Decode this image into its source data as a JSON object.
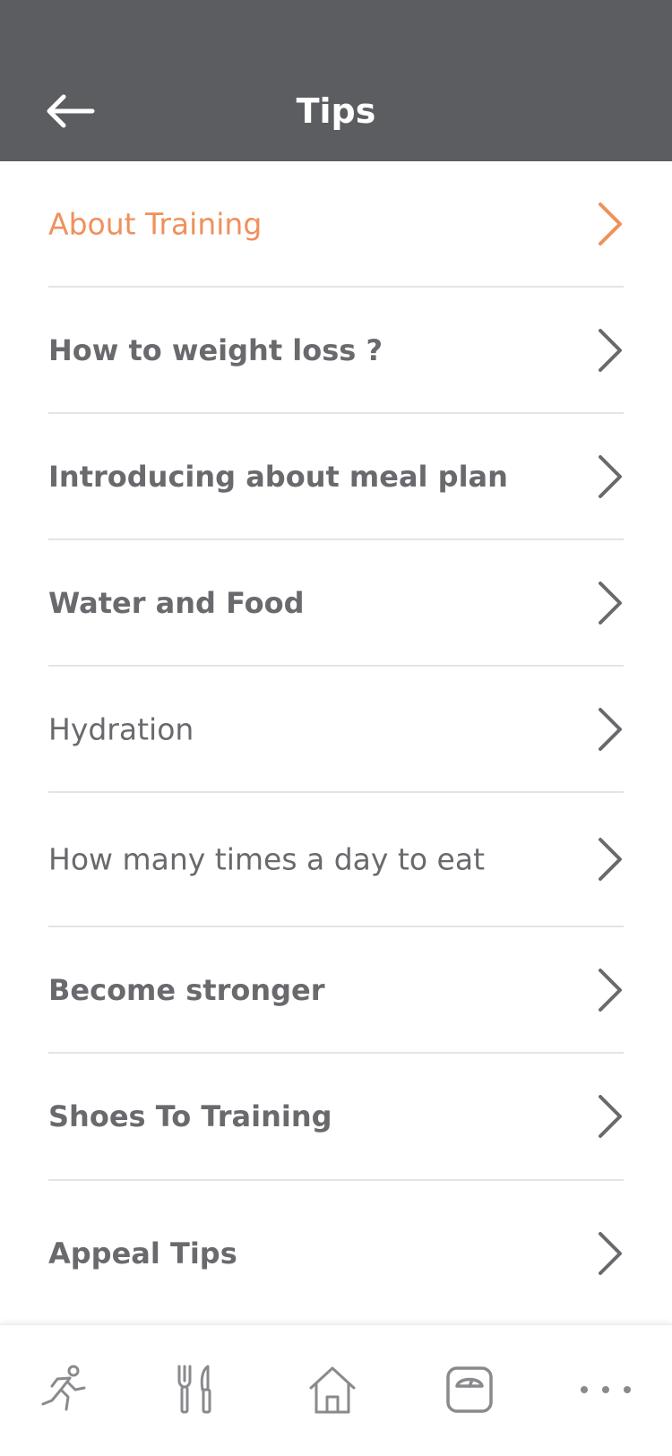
{
  "header": {
    "title": "Tips",
    "back_icon": "arrow-left-icon"
  },
  "colors": {
    "header_bg": "#5c5d61",
    "accent": "#f0905c",
    "text": "#6a6a6e",
    "divider": "#e4e4e6"
  },
  "tips": [
    {
      "label": "About Training",
      "active": true
    },
    {
      "label": "How to weight loss ?",
      "active": false
    },
    {
      "label": "Introducing about meal plan",
      "active": false
    },
    {
      "label": "Water and Food",
      "active": false
    },
    {
      "label": "Hydration",
      "active": false
    },
    {
      "label": "How many times a day to eat",
      "active": false
    },
    {
      "label": "Become stronger",
      "active": false
    },
    {
      "label": "Shoes To Training",
      "active": false
    },
    {
      "label": "Appeal Tips",
      "active": false
    }
  ],
  "tabbar": {
    "items": [
      {
        "icon": "running-icon"
      },
      {
        "icon": "fork-knife-icon"
      },
      {
        "icon": "home-icon"
      },
      {
        "icon": "scale-icon"
      },
      {
        "icon": "more-icon"
      }
    ]
  }
}
